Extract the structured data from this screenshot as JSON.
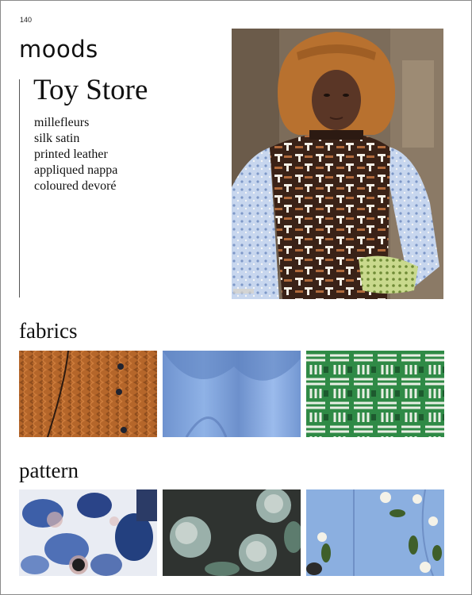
{
  "page": {
    "number": "140",
    "section_title": "moods"
  },
  "mood": {
    "title": "Toy Store",
    "materials": [
      "millefleurs",
      "silk satin",
      "printed leather",
      "appliqued nappa",
      "coloured devoré"
    ]
  },
  "hero_image": {
    "caption_mark": "catwalk photo",
    "colors": {
      "hat": "#b8712f",
      "vest_dark": "#3a2217",
      "vest_light": "#f3efe6",
      "vest_tan": "#b06a3c",
      "sleeve": "#b8c9e6",
      "background": "#7c6c5a"
    }
  },
  "fabrics": {
    "label": "fabrics",
    "swatches": [
      {
        "name": "rust cable knit with buttons",
        "color": "#b5662a"
      },
      {
        "name": "cornflower blue draped satin",
        "color": "#7ea3dc"
      },
      {
        "name": "green geometric print",
        "color": "#2f8a46"
      }
    ]
  },
  "pattern": {
    "label": "pattern",
    "swatches": [
      {
        "name": "blue floral with sequins",
        "color": "#3d5fa8"
      },
      {
        "name": "dark leather with appliqued peonies",
        "color": "#2f3330"
      },
      {
        "name": "blue leather with floral applique",
        "color": "#8bafe0"
      }
    ]
  }
}
